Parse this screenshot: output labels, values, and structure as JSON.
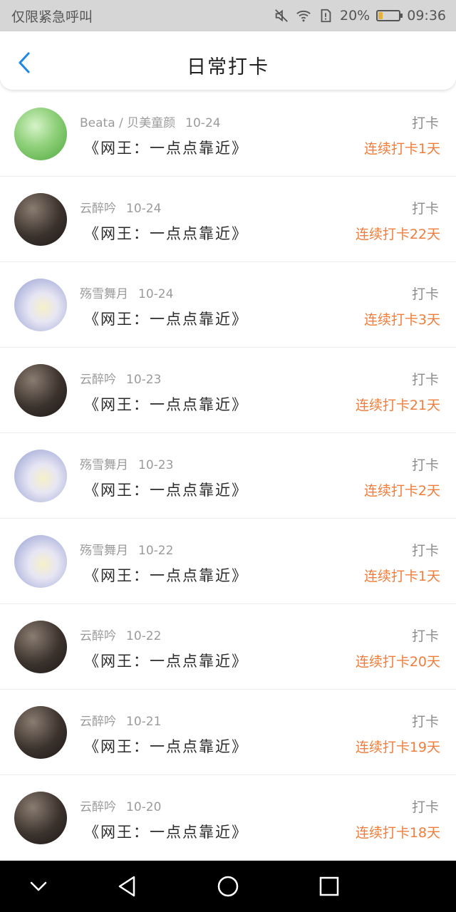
{
  "status_bar": {
    "carrier": "仅限紧急呼叫",
    "battery_percent": "20%",
    "time": "09:36",
    "battery_level": 0.2,
    "icons": [
      "mute-icon",
      "wifi-icon",
      "sim-alert-icon",
      "battery-icon"
    ]
  },
  "header": {
    "title": "日常打卡",
    "back_icon": "chevron-left-icon",
    "accent": "#1e88e5"
  },
  "list": {
    "items": [
      {
        "user": "Beata / 贝美童颜",
        "date": "10-24",
        "book": "《网王：一点点靠近》",
        "action": "打卡",
        "streak": "连续打卡1天",
        "avatar": "green"
      },
      {
        "user": "云醉吟",
        "date": "10-24",
        "book": "《网王：一点点靠近》",
        "action": "打卡",
        "streak": "连续打卡22天",
        "avatar": "dark"
      },
      {
        "user": "殇雪舞月",
        "date": "10-24",
        "book": "《网王：一点点靠近》",
        "action": "打卡",
        "streak": "连续打卡3天",
        "avatar": "anime"
      },
      {
        "user": "云醉吟",
        "date": "10-23",
        "book": "《网王：一点点靠近》",
        "action": "打卡",
        "streak": "连续打卡21天",
        "avatar": "dark"
      },
      {
        "user": "殇雪舞月",
        "date": "10-23",
        "book": "《网王：一点点靠近》",
        "action": "打卡",
        "streak": "连续打卡2天",
        "avatar": "anime"
      },
      {
        "user": "殇雪舞月",
        "date": "10-22",
        "book": "《网王：一点点靠近》",
        "action": "打卡",
        "streak": "连续打卡1天",
        "avatar": "anime"
      },
      {
        "user": "云醉吟",
        "date": "10-22",
        "book": "《网王：一点点靠近》",
        "action": "打卡",
        "streak": "连续打卡20天",
        "avatar": "dark"
      },
      {
        "user": "云醉吟",
        "date": "10-21",
        "book": "《网王：一点点靠近》",
        "action": "打卡",
        "streak": "连续打卡19天",
        "avatar": "dark"
      },
      {
        "user": "云醉吟",
        "date": "10-20",
        "book": "《网王：一点点靠近》",
        "action": "打卡",
        "streak": "连续打卡18天",
        "avatar": "dark"
      }
    ],
    "streak_color": "#f07d3b"
  },
  "nav_bar": {
    "icons": [
      "chevron-down-icon",
      "back-triangle-icon",
      "home-circle-icon",
      "recents-square-icon"
    ]
  }
}
